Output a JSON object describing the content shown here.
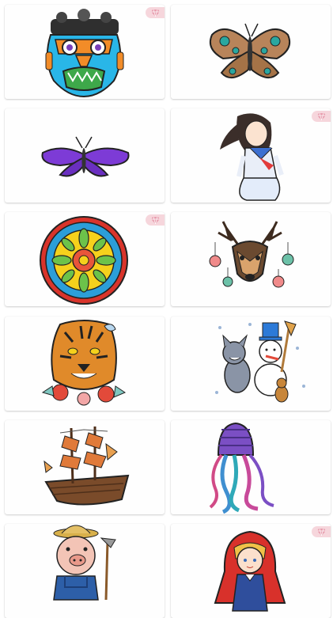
{
  "app": {
    "screen": "coloring-gallery"
  },
  "colors": {
    "background": "#ffffff",
    "card": "#fefefe",
    "premium_badge": "#f6d6dc",
    "gem": "#e8a0b0"
  },
  "gallery": {
    "items": [
      {
        "name": "tribal-mask",
        "icon": "tribal-mask-illustration",
        "premium": true
      },
      {
        "name": "butterfly-brown",
        "icon": "butterfly-illustration",
        "premium": false
      },
      {
        "name": "butterfly-purple",
        "icon": "butterfly-illustration",
        "premium": false
      },
      {
        "name": "anime-girl",
        "icon": "anime-girl-illustration",
        "premium": true
      },
      {
        "name": "mandala",
        "icon": "mandala-illustration",
        "premium": true
      },
      {
        "name": "deer-ornaments",
        "icon": "deer-illustration",
        "premium": false
      },
      {
        "name": "tiger-flowers",
        "icon": "tiger-illustration",
        "premium": false
      },
      {
        "name": "cat-mouse-snowman",
        "icon": "cartoon-illustration",
        "premium": false
      },
      {
        "name": "pirate-ship",
        "icon": "ship-illustration",
        "premium": false
      },
      {
        "name": "jellyfish",
        "icon": "jellyfish-illustration",
        "premium": false
      },
      {
        "name": "farmer-pig",
        "icon": "pig-farmer-illustration",
        "premium": false
      },
      {
        "name": "red-riding-hood",
        "icon": "red-riding-hood-illustration",
        "premium": true
      }
    ]
  }
}
